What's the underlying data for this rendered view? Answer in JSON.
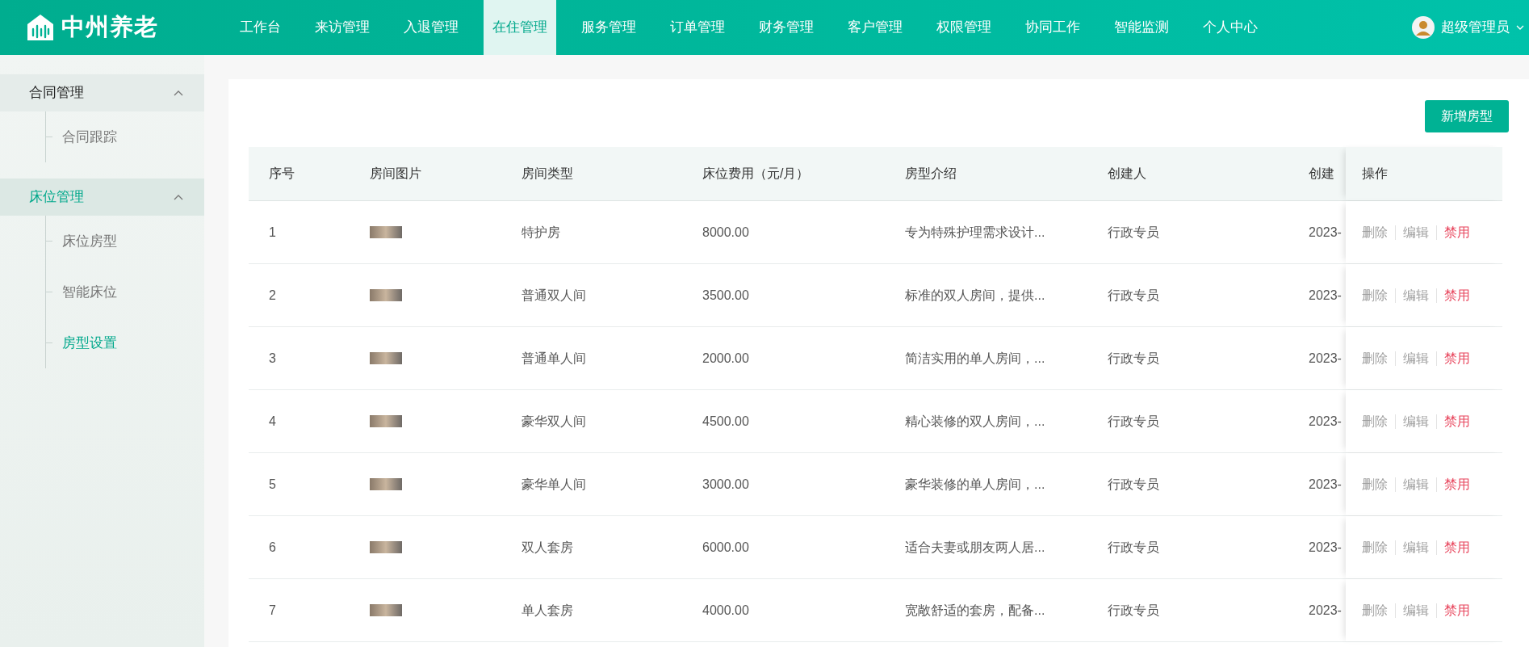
{
  "header": {
    "logo_text": "中州养老",
    "nav": [
      {
        "label": "工作台",
        "selected": false
      },
      {
        "label": "来访管理",
        "selected": false
      },
      {
        "label": "入退管理",
        "selected": false
      },
      {
        "label": "在住管理",
        "selected": true
      },
      {
        "label": "服务管理",
        "selected": false
      },
      {
        "label": "订单管理",
        "selected": false
      },
      {
        "label": "财务管理",
        "selected": false
      },
      {
        "label": "客户管理",
        "selected": false
      },
      {
        "label": "权限管理",
        "selected": false
      },
      {
        "label": "协同工作",
        "selected": false
      },
      {
        "label": "智能监测",
        "selected": false
      },
      {
        "label": "个人中心",
        "selected": false
      }
    ],
    "user": "超级管理员"
  },
  "sidebar": {
    "groups": [
      {
        "label": "合同管理",
        "expanded": true,
        "selected": false,
        "children": [
          {
            "label": "合同跟踪",
            "selected": false
          }
        ]
      },
      {
        "label": "床位管理",
        "expanded": true,
        "selected": true,
        "children": [
          {
            "label": "床位房型",
            "selected": false
          },
          {
            "label": "智能床位",
            "selected": false
          },
          {
            "label": "房型设置",
            "selected": true
          }
        ]
      }
    ]
  },
  "toolbar": {
    "add_button": "新增房型"
  },
  "table": {
    "columns": [
      "序号",
      "房间图片",
      "房间类型",
      "床位费用（元/月）",
      "房型介绍",
      "创建人",
      "创建",
      "操作"
    ],
    "rows": [
      {
        "index": "1",
        "type": "特护房",
        "fee": "8000.00",
        "intro": "专为特殊护理需求设计...",
        "creator": "行政专员",
        "created": "2023-",
        "actions": [
          {
            "label": "删除",
            "kind": "normal"
          },
          {
            "label": "编辑",
            "kind": "normal"
          },
          {
            "label": "禁用",
            "kind": "danger"
          }
        ]
      },
      {
        "index": "2",
        "type": "普通双人间",
        "fee": "3500.00",
        "intro": "标准的双人房间，提供...",
        "creator": "行政专员",
        "created": "2023-",
        "actions": [
          {
            "label": "删除",
            "kind": "normal"
          },
          {
            "label": "编辑",
            "kind": "normal"
          },
          {
            "label": "禁用",
            "kind": "danger"
          }
        ]
      },
      {
        "index": "3",
        "type": "普通单人间",
        "fee": "2000.00",
        "intro": "简洁实用的单人房间，...",
        "creator": "行政专员",
        "created": "2023-",
        "actions": [
          {
            "label": "删除",
            "kind": "normal"
          },
          {
            "label": "编辑",
            "kind": "normal"
          },
          {
            "label": "禁用",
            "kind": "danger"
          }
        ]
      },
      {
        "index": "4",
        "type": "豪华双人间",
        "fee": "4500.00",
        "intro": "精心装修的双人房间，...",
        "creator": "行政专员",
        "created": "2023-",
        "actions": [
          {
            "label": "删除",
            "kind": "normal"
          },
          {
            "label": "编辑",
            "kind": "normal"
          },
          {
            "label": "禁用",
            "kind": "danger"
          }
        ]
      },
      {
        "index": "5",
        "type": "豪华单人间",
        "fee": "3000.00",
        "intro": "豪华装修的单人房间，...",
        "creator": "行政专员",
        "created": "2023-",
        "actions": [
          {
            "label": "删除",
            "kind": "normal"
          },
          {
            "label": "编辑",
            "kind": "normal"
          },
          {
            "label": "禁用",
            "kind": "danger"
          }
        ]
      },
      {
        "index": "6",
        "type": "双人套房",
        "fee": "6000.00",
        "intro": "适合夫妻或朋友两人居...",
        "creator": "行政专员",
        "created": "2023-",
        "actions": [
          {
            "label": "删除",
            "kind": "normal"
          },
          {
            "label": "编辑",
            "kind": "normal"
          },
          {
            "label": "禁用",
            "kind": "danger"
          }
        ]
      },
      {
        "index": "7",
        "type": "单人套房",
        "fee": "4000.00",
        "intro": "宽敞舒适的套房，配备...",
        "creator": "行政专员",
        "created": "2023-",
        "actions": [
          {
            "label": "删除",
            "kind": "normal"
          },
          {
            "label": "编辑",
            "kind": "normal"
          },
          {
            "label": "禁用",
            "kind": "danger"
          }
        ]
      }
    ]
  }
}
